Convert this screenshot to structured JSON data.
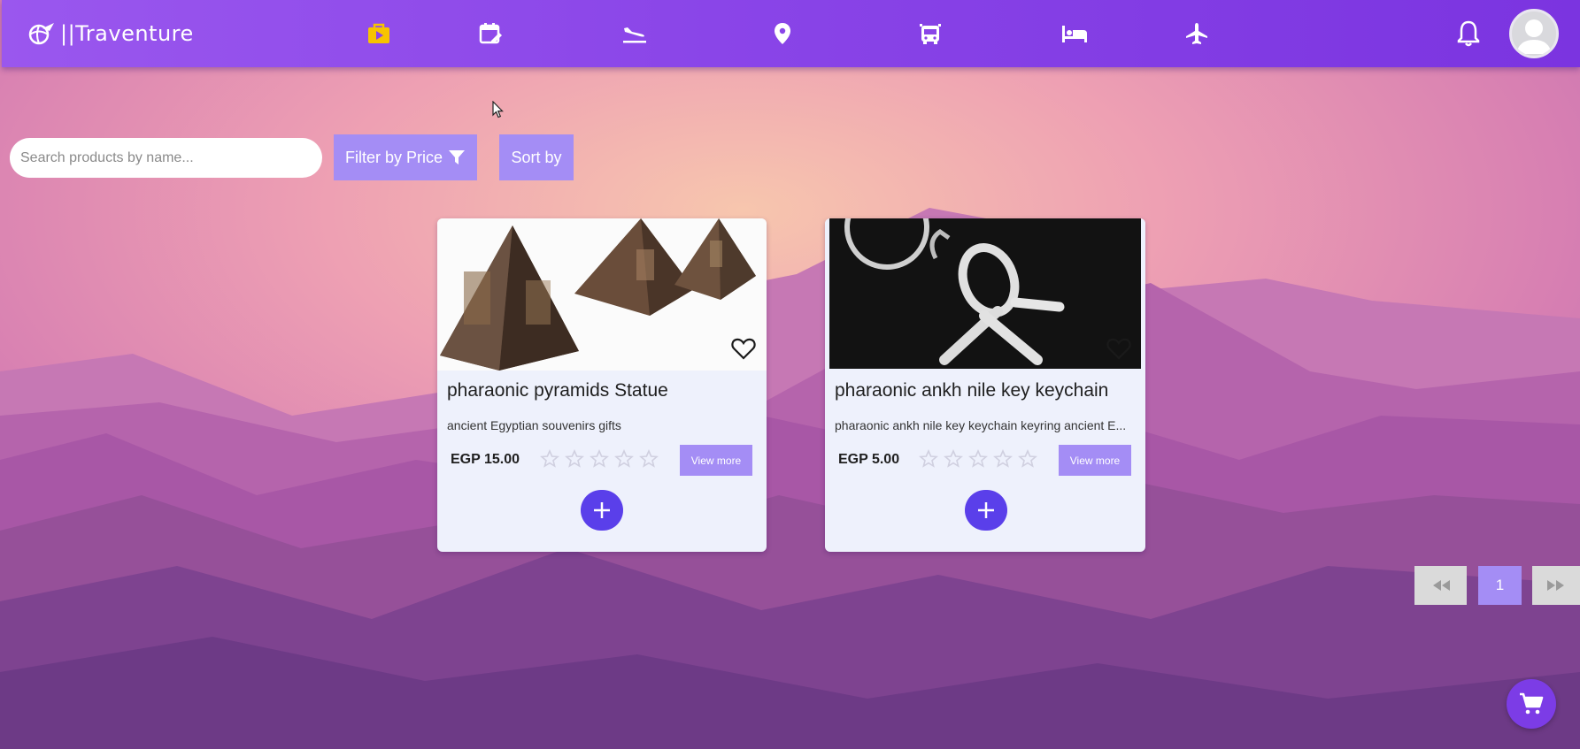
{
  "app": {
    "name": "Traventure",
    "logo_prefix": "||"
  },
  "nav": {
    "icons": [
      "shop-bag-icon",
      "calendar-edit-icon",
      "flight-land-icon",
      "location-pin-icon",
      "bus-icon",
      "bed-icon",
      "airplane-icon"
    ],
    "active_icon": "shop-bag-icon",
    "active_color": "#f7c400"
  },
  "search": {
    "placeholder": "Search products by name...",
    "value": ""
  },
  "filters": {
    "filter_label": "Filter by Price",
    "sort_label": "Sort by"
  },
  "products": [
    {
      "title": "pharaonic pyramids Statue",
      "description": "ancient Egyptian souvenirs gifts",
      "price": "EGP 15.00",
      "rating": 0,
      "view_more_label": "View more",
      "add_label": "+"
    },
    {
      "title": "pharaonic ankh nile key keychain",
      "description": "pharaonic ankh nile key keychain keyring ancient E...",
      "price": "EGP 5.00",
      "rating": 0,
      "view_more_label": "View more",
      "add_label": "+"
    }
  ],
  "pagination": {
    "current_page": "1"
  },
  "colors": {
    "nav_start": "#9a57ee",
    "nav_end": "#7b34e0",
    "button": "#a48df5",
    "add_button": "#5a3fea",
    "cart": "#7c3ce6"
  }
}
